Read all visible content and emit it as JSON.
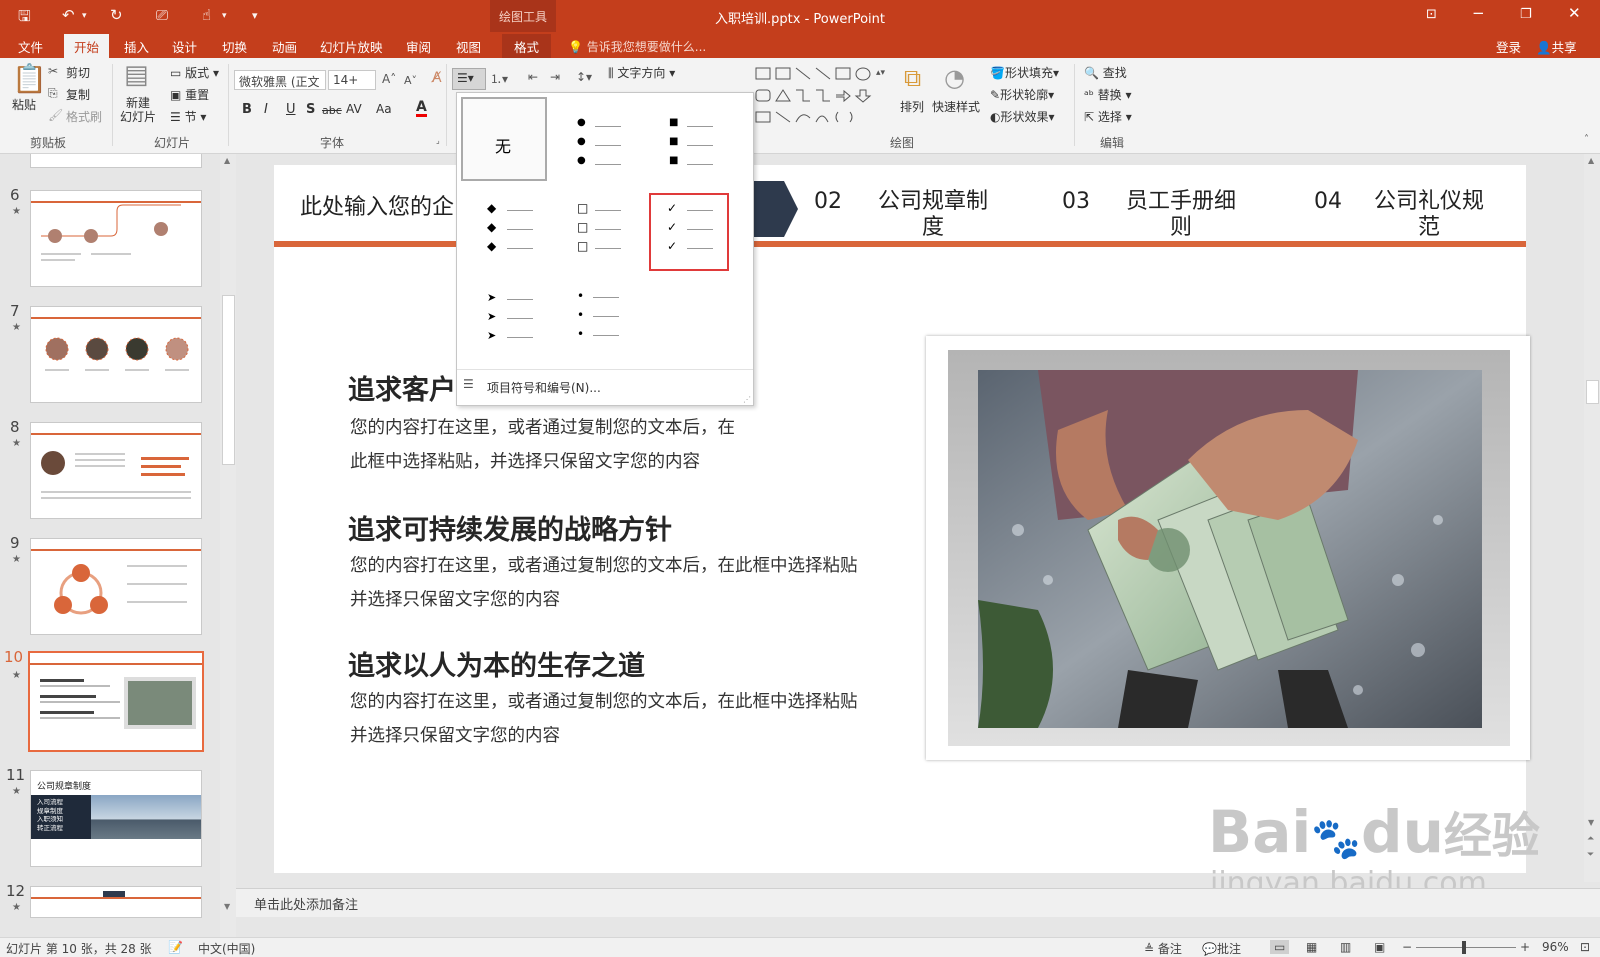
{
  "titlebar": {
    "context_label": "绘图工具",
    "title": "入职培训.pptx - PowerPoint"
  },
  "tabs": [
    "文件",
    "开始",
    "插入",
    "设计",
    "切换",
    "动画",
    "幻灯片放映",
    "审阅",
    "视图",
    "格式"
  ],
  "tell_me": "告诉我您想要做什么...",
  "account": {
    "login": "登录",
    "share": "共享"
  },
  "ribbon": {
    "clipboard": {
      "paste": "粘贴",
      "cut": "剪切",
      "copy": "复制",
      "format_painter": "格式刷",
      "group": "剪贴板"
    },
    "slides": {
      "new_slide": "新建\n幻灯片",
      "layout": "版式",
      "reset": "重置",
      "section": "节",
      "group": "幻灯片"
    },
    "font": {
      "face": "微软雅黑 (正文",
      "size": "14+",
      "bold": "B",
      "italic": "I",
      "underline": "U",
      "shadow": "S",
      "strike": "abc",
      "spacing": "AV",
      "case": "Aa",
      "color": "A",
      "group": "字体"
    },
    "paragraph": {
      "text_direction": "文字方向"
    },
    "drawing": {
      "arrange": "排列",
      "quick_styles": "快速样式",
      "shape_fill": "形状填充",
      "shape_outline": "形状轮廓",
      "shape_effects": "形状效果",
      "group": "绘图"
    },
    "editing": {
      "find": "查找",
      "replace": "替换",
      "select": "选择",
      "group": "编辑"
    }
  },
  "bullet_dropdown": {
    "none_label": "无",
    "footer": "项目符号和编号(N)...",
    "glyphs": [
      "●",
      "■",
      "◆",
      "□",
      "✓",
      "➤",
      "•"
    ]
  },
  "thumbnails": [
    {
      "num": "6"
    },
    {
      "num": "7"
    },
    {
      "num": "8"
    },
    {
      "num": "9"
    },
    {
      "num": "10",
      "selected": true
    },
    {
      "num": "11",
      "title": "公司规章制度",
      "items": [
        "入司流程",
        "规章制度",
        "入职须知",
        "转正流程"
      ]
    },
    {
      "num": "12"
    }
  ],
  "slide": {
    "nav": [
      {
        "text": "此处输入您的企"
      },
      {
        "num": "02",
        "text": "公司规章制\n度"
      },
      {
        "num": "03",
        "text": "员工手册细\n则"
      },
      {
        "num": "04",
        "text": "公司礼仪规\n范"
      }
    ],
    "sections": [
      {
        "heading": "追求客户",
        "lines": [
          "您的内容打在这里，或者通过复制您的文本后，在",
          "此框中选择粘贴，并选择只保留文字您的内容"
        ]
      },
      {
        "heading": "追求可持续发展的战略方针",
        "lines": [
          "您的内容打在这里，或者通过复制您的文本后，在此框中选择粘贴",
          "并选择只保留文字您的内容"
        ]
      },
      {
        "heading": "追求以人为本的生存之道",
        "lines": [
          "您的内容打在这里，或者通过复制您的文本后，在此框中选择粘贴",
          "并选择只保留文字您的内容"
        ]
      }
    ]
  },
  "notes_placeholder": "单击此处添加备注",
  "status": {
    "slide_info": "幻灯片 第 10 张，共 28 张",
    "language": "中文(中国)",
    "notes": "备注",
    "comments": "批注",
    "zoom": "96%"
  },
  "watermark": {
    "brand": "Bai",
    "brand2": "du",
    "cn": "经验",
    "url": "jingyan.baidu.com"
  },
  "colors": {
    "accent": "#c43e1c",
    "slide_accent": "#d9663a",
    "nav_chevron": "#2e3a4d",
    "highlight": "#e03a3a"
  }
}
